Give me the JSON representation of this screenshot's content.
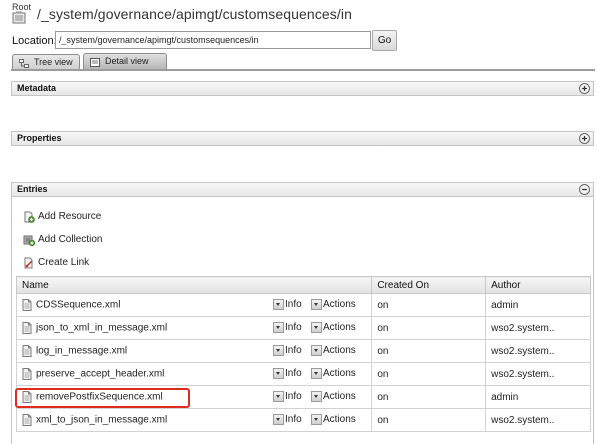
{
  "header": {
    "root_label": "Root",
    "path_title": "/_system/governance/apimgt/customsequences/in"
  },
  "location": {
    "label": "Location:",
    "value": "/_system/governance/apimgt/customsequences/in",
    "go_label": "Go"
  },
  "tabs": [
    {
      "label": "Tree view",
      "active": false
    },
    {
      "label": "Detail view",
      "active": true
    }
  ],
  "sections": {
    "metadata": "Metadata",
    "properties": "Properties",
    "entries": "Entries"
  },
  "entry_actions": {
    "add_resource": "Add Resource",
    "add_collection": "Add Collection",
    "create_link": "Create Link"
  },
  "table": {
    "columns": [
      "Name",
      "Created On",
      "Author"
    ],
    "info_label": "Info",
    "actions_label": "Actions",
    "rows": [
      {
        "name": "CDSSequence.xml",
        "created_on": "on",
        "author": "admin"
      },
      {
        "name": "json_to_xml_in_message.xml",
        "created_on": "on",
        "author": "wso2.system.."
      },
      {
        "name": "log_in_message.xml",
        "created_on": "on",
        "author": "wso2.system.."
      },
      {
        "name": "preserve_accept_header.xml",
        "created_on": "on",
        "author": "wso2.system.."
      },
      {
        "name": "removePostfixSequence.xml",
        "created_on": "on",
        "author": "admin",
        "highlighted": true
      },
      {
        "name": "xml_to_json_in_message.xml",
        "created_on": "on",
        "author": "wso2.system.."
      }
    ]
  },
  "colors": {
    "highlight": "#e02b20",
    "section_bg": "#eeeeee"
  },
  "icons": {
    "root": "folder-root-icon",
    "tree_tab": "tree-icon",
    "detail_tab": "detail-page-icon",
    "expand": "plus-circle-icon",
    "collapse": "minus-circle-icon",
    "add_resource": "add-resource-icon",
    "add_collection": "add-collection-icon",
    "create_link": "link-icon",
    "file": "document-icon"
  }
}
